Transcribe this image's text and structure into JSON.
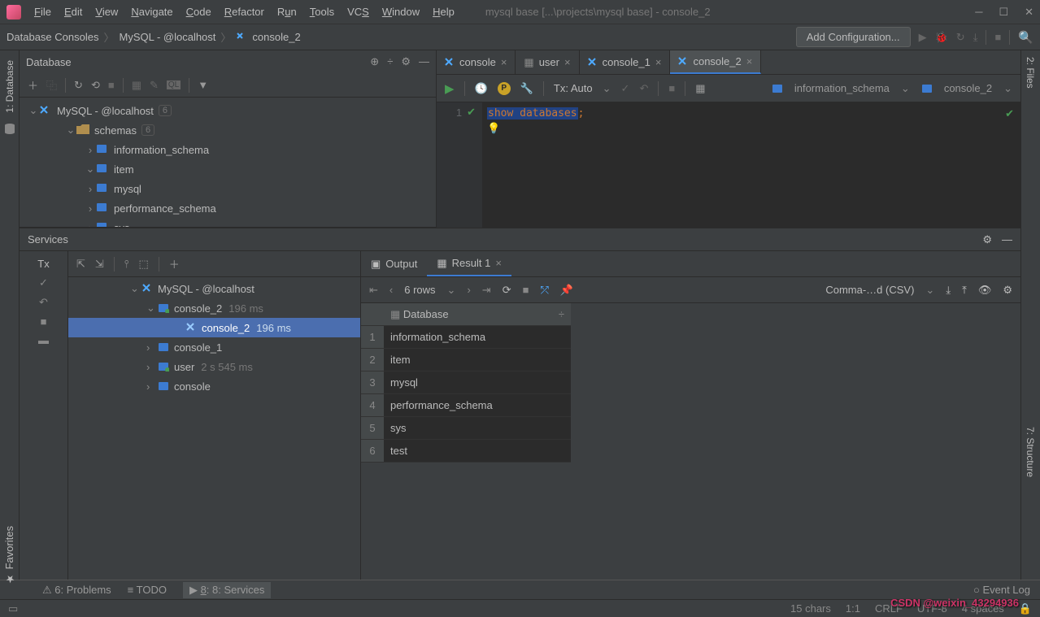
{
  "window": {
    "title": "mysql base [...\\projects\\mysql base] - console_2"
  },
  "menu": [
    "File",
    "Edit",
    "View",
    "Navigate",
    "Code",
    "Refactor",
    "Run",
    "Tools",
    "VCS",
    "Window",
    "Help"
  ],
  "breadcrumb": [
    "Database Consoles",
    "MySQL - @localhost",
    "console_2"
  ],
  "toolbar": {
    "add_config": "Add Configuration..."
  },
  "left_rail": {
    "label": "1: Database"
  },
  "right_rail": {
    "label1": "2: Files",
    "label2": "7: Structure"
  },
  "db_panel": {
    "title": "Database",
    "tree_root": "MySQL - @localhost",
    "root_count": "6",
    "schemas_label": "schemas",
    "schemas_count": "6",
    "items": [
      "information_schema",
      "item",
      "mysql",
      "performance_schema",
      "sys"
    ]
  },
  "editor": {
    "tabs": [
      {
        "label": "console",
        "active": false
      },
      {
        "label": "user",
        "active": false
      },
      {
        "label": "console_1",
        "active": false
      },
      {
        "label": "console_2",
        "active": true
      }
    ],
    "tx_mode": "Tx: Auto",
    "schema": "information_schema",
    "console": "console_2",
    "code_keyword": "show databases",
    "code_semi": ";",
    "line_num": "1"
  },
  "services": {
    "title": "Services",
    "sidebar_label": "Tx",
    "tree": {
      "root": "MySQL - @localhost",
      "c2": "console_2",
      "c2_time": "196 ms",
      "c2_child": "console_2",
      "c2_child_time": "196 ms",
      "c1": "console_1",
      "user": "user",
      "user_time": "2 s 545 ms",
      "cons": "console"
    },
    "tabs": {
      "output": "Output",
      "result": "Result 1"
    },
    "rows_label": "6 rows",
    "export_fmt": "Comma-…d (CSV)",
    "col_header": "Database",
    "rows": [
      "information_schema",
      "item",
      "mysql",
      "performance_schema",
      "sys",
      "test"
    ]
  },
  "bottom_tabs": {
    "problems": "6: Problems",
    "todo": "TODO",
    "services": "8: Services",
    "eventlog": "Event Log"
  },
  "status": {
    "chars": "15 chars",
    "pos": "1:1",
    "crlf": "CRLF",
    "enc": "UTF-8",
    "spaces": "4 spaces"
  },
  "watermark": "CSDN @weixin_43294936",
  "chart_data": {
    "type": "table",
    "columns": [
      "Database"
    ],
    "rows": [
      [
        "information_schema"
      ],
      [
        "item"
      ],
      [
        "mysql"
      ],
      [
        "performance_schema"
      ],
      [
        "sys"
      ],
      [
        "test"
      ]
    ]
  }
}
